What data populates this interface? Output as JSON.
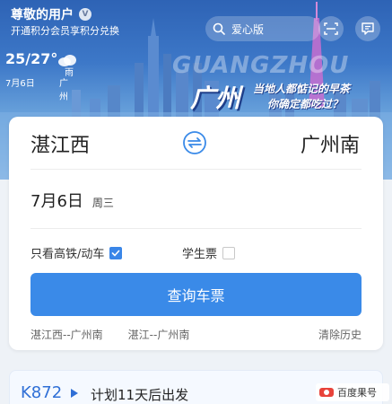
{
  "header": {
    "greeting": "尊敬的用户",
    "vip_badge": "V",
    "points_promo": "开通积分会员享积分兑换"
  },
  "weather": {
    "temperature": "25/27°",
    "date": "7月6日",
    "condition": "雨",
    "city": "广州"
  },
  "search": {
    "label": "爱心版"
  },
  "banner": {
    "english": "GUANGZHOU",
    "chinese": "广州",
    "promo_line_1": "当地人都惦记的早茶",
    "promo_line_2": "你确定都吃过？"
  },
  "booking": {
    "from_station": "湛江西",
    "to_station": "广州南",
    "date": "7月6日",
    "weekday": "周三",
    "option_highspeed": "只看高铁/动车",
    "option_highspeed_checked": true,
    "option_student": "学生票",
    "option_student_checked": false,
    "query_button": "查询车票",
    "history": [
      "湛江西--广州南",
      "湛江--广州南"
    ],
    "clear_history": "清除历史"
  },
  "trip": {
    "train_no": "K872",
    "status": "计划11天后出发"
  },
  "watermark": {
    "text": "百度果号"
  },
  "colors": {
    "primary": "#3a8ae8",
    "hero_top": "#2e63b5",
    "train_no": "#2f6fd6"
  }
}
